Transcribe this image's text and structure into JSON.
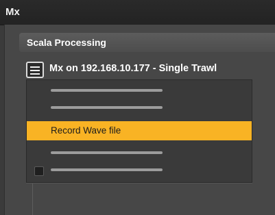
{
  "window": {
    "title": "Mx"
  },
  "section": {
    "title": "Scala Processing"
  },
  "device": {
    "title": "Mx on 192.168.10.177 - Single Trawl",
    "menu_icon": "hamburger-menu-icon"
  },
  "dropdown": {
    "items": [
      {
        "label": ""
      },
      {
        "label": ""
      },
      {
        "label": "Record Wave file",
        "highlighted": true,
        "highlight_color": "#f9b324"
      },
      {
        "label": ""
      },
      {
        "label": "",
        "has_checkbox": true,
        "checked": false
      }
    ]
  },
  "colors": {
    "background": "#3b3b3b",
    "titlebar": "#232323",
    "accent": "#f9b324"
  }
}
